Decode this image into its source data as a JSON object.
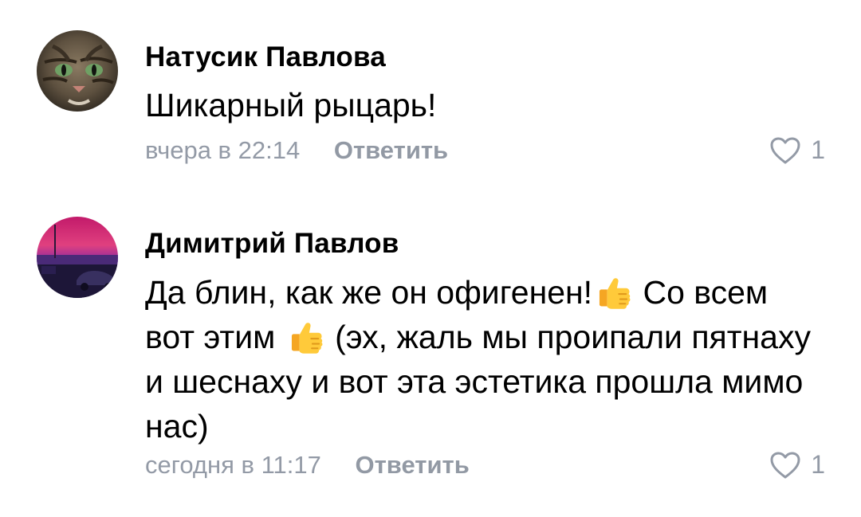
{
  "comments": [
    {
      "author": "Натусик Павлова",
      "avatar_icon": "cat-avatar",
      "text": "Шикарный рыцарь!",
      "time": "вчера в 22:14",
      "reply_label": "Ответить",
      "likes": "1"
    },
    {
      "author": "Димитрий Павлов",
      "avatar_icon": "sunset-avatar",
      "text_parts": [
        "Да блин, как же он офигенен!",
        " Со всем вот этим ",
        " (эх, жаль мы проипали пятнаху и шеснаху и вот эта эстетика прошла мимо нас)"
      ],
      "emoji": "thumbs-up-icon",
      "time": "сегодня в 11:17",
      "reply_label": "Ответить",
      "likes": "1"
    }
  ],
  "colors": {
    "meta_text": "#939aa6",
    "author_text": "#000000",
    "body_text": "#000000"
  }
}
